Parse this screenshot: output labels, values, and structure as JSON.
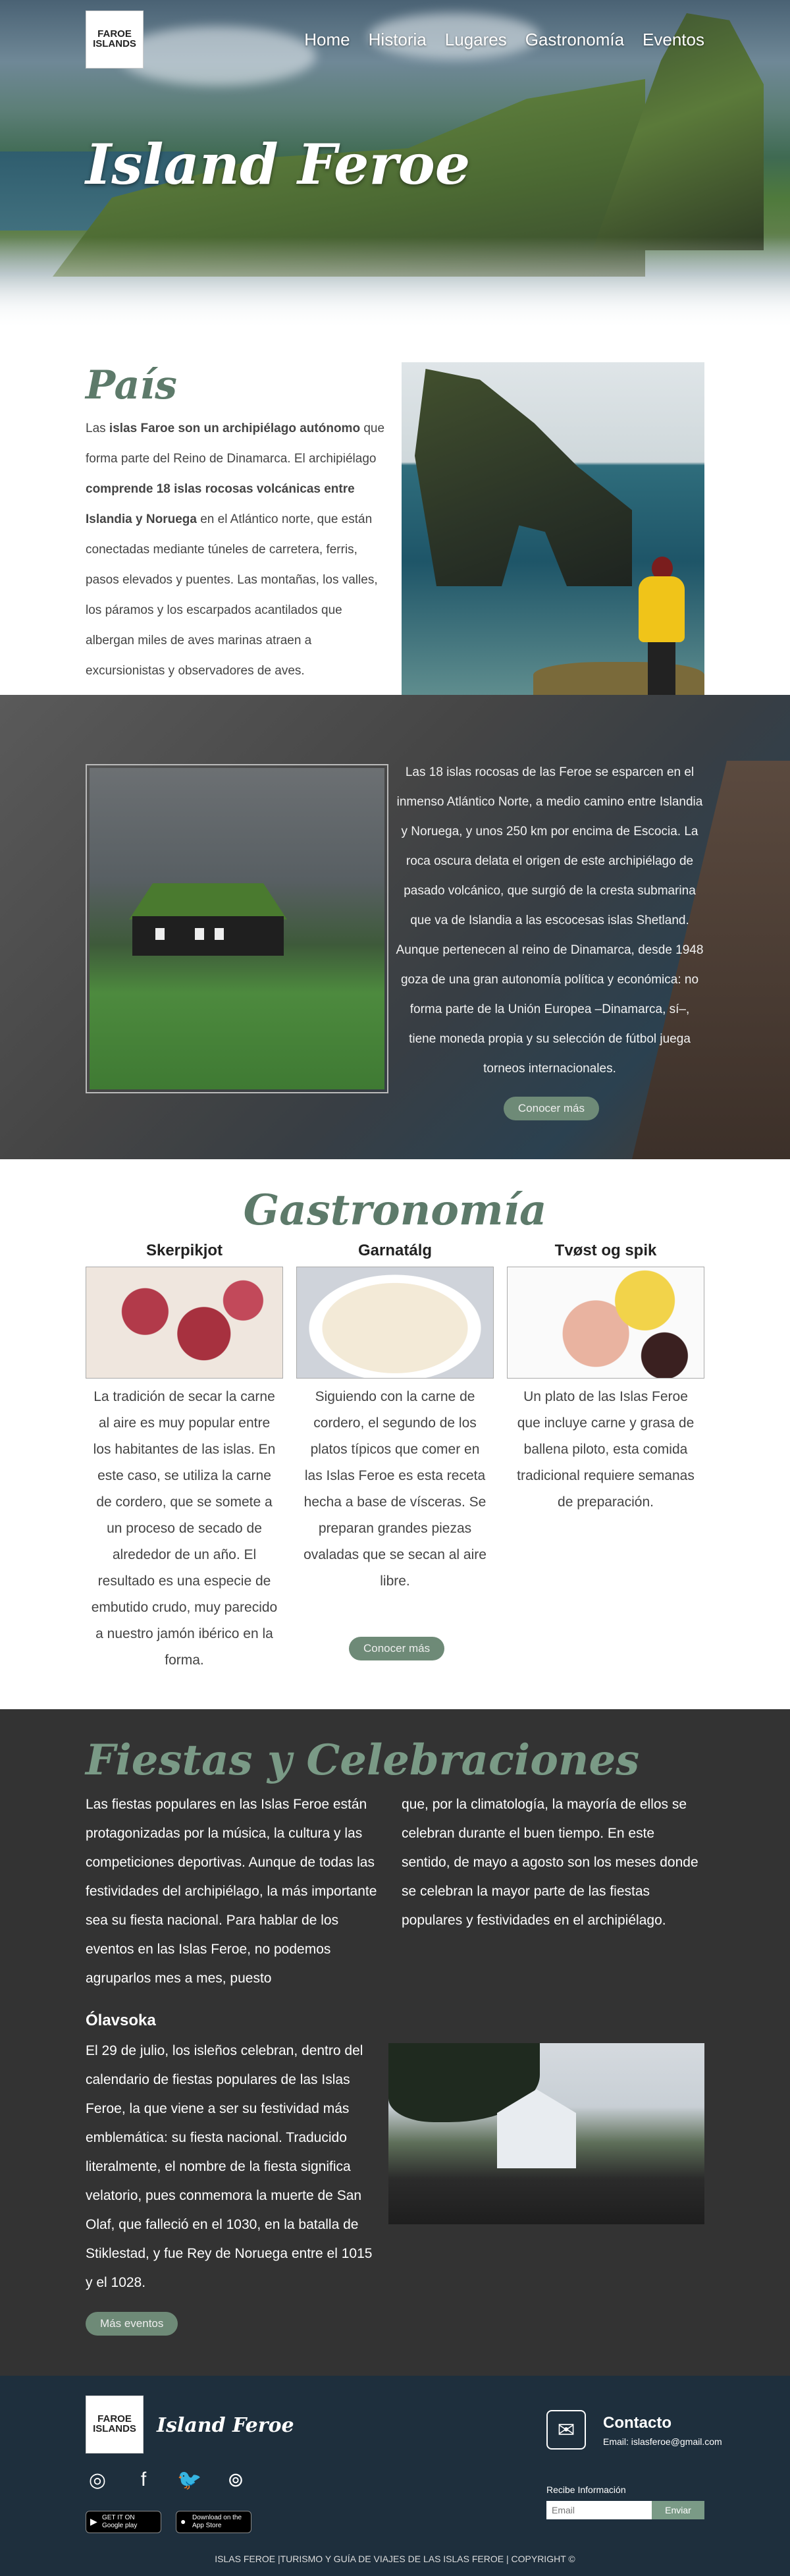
{
  "header": {
    "logo_line1": "FAROE",
    "logo_line2": "ISLANDS",
    "logo_small": "",
    "nav": [
      "Home",
      "Historia",
      "Lugares",
      "Gastronomía",
      "Eventos"
    ],
    "title": "Island Feroe"
  },
  "pais": {
    "title": "País",
    "p_intro": "Las ",
    "p_bold1": "islas Faroe son un archipiélago autónomo",
    "p_mid1": " que forma parte del Reino de Dinamarca. El archipiélago ",
    "p_bold2": "comprende 18 islas rocosas volcánicas entre Islandia y Noruega",
    "p_end": " en el Atlántico norte, que están conectadas mediante túneles de carretera, ferris, pasos elevados y puentes. Las montañas, los valles, los páramos y los escarpados acantilados que albergan miles de aves marinas atraen a excursionistas y observadores de aves."
  },
  "islas": {
    "text": "Las 18 islas rocosas de las Feroe se esparcen en el inmenso Atlántico Norte, a medio camino entre Islandia y Noruega, y unos 250 km por encima de Escocia. La roca oscura delata el origen de este archipiélago de pasado volcánico, que surgió de la cresta submarina que va de Islandia a las escocesas islas Shetland. Aunque pertenecen al reino de Dinamarca, desde 1948 goza de una gran autonomía política y económica: no forma parte de la Unión Europea –Dinamarca, sí–, tiene moneda propia y su selección de fútbol juega torneos internacionales.",
    "button": "Conocer más"
  },
  "gastronomia": {
    "title": "Gastronomía",
    "items": [
      {
        "name": "Skerpikjot",
        "text": "La tradición de secar la carne al aire es muy popular entre los habitantes de las islas. En este caso, se utiliza la carne de cordero, que se somete a un proceso de secado de alrededor de un año. El resultado es una especie de embutido crudo, muy parecido a nuestro jamón ibérico en la forma."
      },
      {
        "name": "Garnatálg",
        "text": "Siguiendo con la carne de cordero, el segundo de los platos típicos que comer en las Islas Feroe es esta receta hecha a base de vísceras. Se preparan grandes piezas ovaladas que se secan al aire libre."
      },
      {
        "name": "Tvøst og spik",
        "text": "Un plato de las Islas Feroe que incluye carne y grasa de ballena piloto, esta comida tradicional requiere semanas de preparación."
      }
    ],
    "button": "Conocer más"
  },
  "fiestas": {
    "title": "Fiestas y Celebraciones",
    "col1": "Las fiestas populares en las Islas Feroe están protagonizadas por la música, la cultura y las competiciones deportivas. Aunque de todas las festividades del archipiélago, la más importante sea su fiesta nacional. Para hablar de los eventos en las Islas Feroe, no podemos agruparlos mes a mes, puesto",
    "col2": "que, por la climatología, la mayoría de ellos se celebran durante el buen tiempo. En este sentido, de mayo a agosto son los meses donde se celebran la mayor parte de las fiestas populares y festividades en el archipiélago.",
    "subtitle": "Ólavsoka",
    "ola_text": "El 29 de julio, los isleños celebran, dentro del calendario de fiestas populares de las Islas Feroe, la que viene a ser su festividad más emblemática: su fiesta nacional. Traducido literalmente, el nombre de la fiesta significa velatorio, pues conmemora la muerte de San Olaf, que falleció en el 1030, en la batalla de Stiklestad, y fue Rey de Noruega entre el 1015 y el 1028.",
    "button": "Más eventos"
  },
  "footer": {
    "brand": "Island Feroe",
    "socials": [
      "instagram-icon",
      "facebook-icon",
      "twitter-icon",
      "tripadvisor-icon"
    ],
    "google_small": "GET IT ON",
    "google": "Google play",
    "apple_small": "Download on the",
    "apple": "App Store",
    "contact_title": "Contacto",
    "contact_mail": "Email: islasferoe@gmail.com",
    "news_label": "Recibe Información",
    "email_placeholder": "Email",
    "send": "Enviar",
    "copyright": "ISLAS FEROE |TURISMO Y GUÍA DE VIAJES DE LAS ISLAS FEROE | COPYRIGHT ©"
  },
  "colors": {
    "accent": "#5d7a6a",
    "button": "#6e8a77",
    "dark": "#333333",
    "footer": "#1e2f3d"
  }
}
